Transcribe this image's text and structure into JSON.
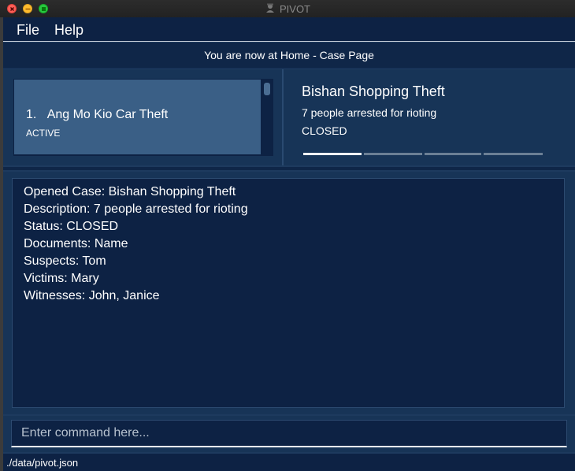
{
  "window": {
    "title": "PIVOT",
    "app_icon": "detective-icon"
  },
  "menu": {
    "file_label": "File",
    "help_label": "Help"
  },
  "notification": {
    "text": "You are now at Home - Case Page"
  },
  "case_list": {
    "items": [
      {
        "index": "1.",
        "title": "Ang Mo Kio Car Theft",
        "status": "ACTIVE"
      }
    ]
  },
  "case_detail": {
    "title": "Bishan Shopping Theft",
    "description": "7 people arrested for rioting",
    "status": "CLOSED",
    "tab_count": 4,
    "active_tab": 0
  },
  "result": {
    "lines": [
      "Opened Case: Bishan Shopping Theft",
      "Description: 7 people arrested for rioting",
      "Status: CLOSED",
      "Documents: Name",
      "Suspects: Tom",
      "Victims: Mary",
      "Witnesses: John, Janice"
    ]
  },
  "command": {
    "placeholder": "Enter command here...",
    "value": ""
  },
  "status_bar": {
    "path": "./data/pivot.json"
  },
  "colors": {
    "background": "#1d3a5e",
    "panel_dark": "#0d2244",
    "card_selected": "#3a5f86",
    "text": "#ffffff"
  }
}
